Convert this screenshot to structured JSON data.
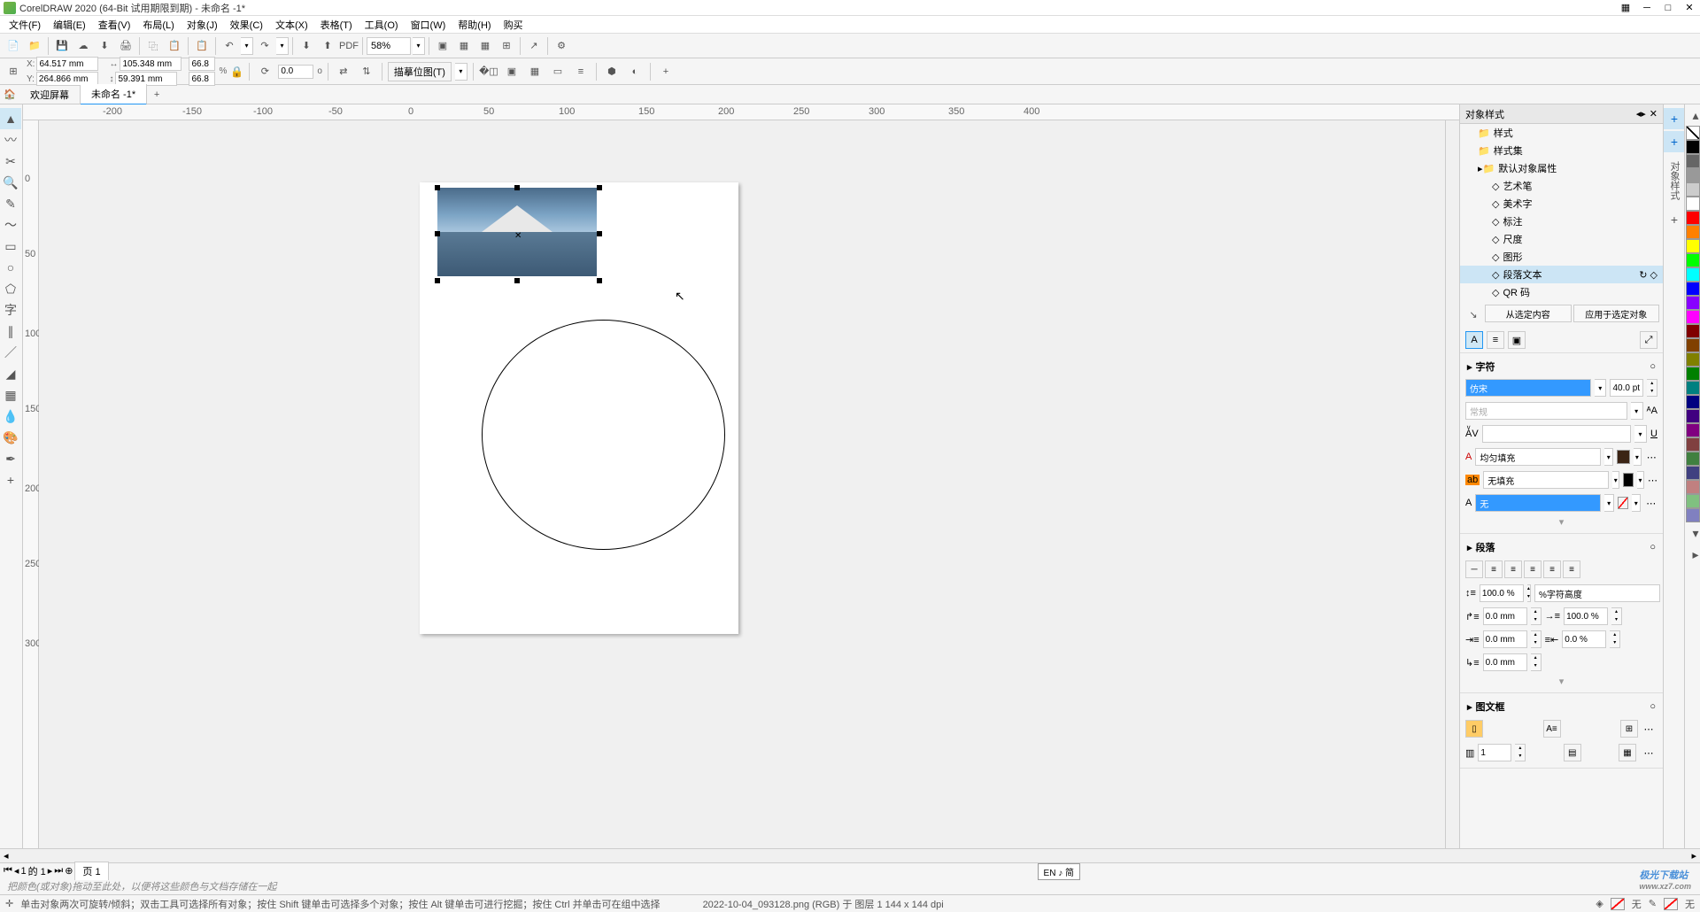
{
  "title": "CorelDRAW 2020 (64-Bit 试用期限到期) - 未命名 -1*",
  "menu": [
    "文件(F)",
    "编辑(E)",
    "查看(V)",
    "布局(L)",
    "对象(J)",
    "效果(C)",
    "文本(X)",
    "表格(T)",
    "工具(O)",
    "窗口(W)",
    "帮助(H)",
    "购买"
  ],
  "zoom": "58%",
  "coords": {
    "x_label": "X:",
    "y_label": "Y:",
    "x": "64.517 mm",
    "y": "264.866 mm",
    "w": "105.348 mm",
    "h": "59.391 mm",
    "sx": "66.8",
    "sy": "66.8",
    "pct": "%",
    "rot": "0.0",
    "deg": "o"
  },
  "trace_label": "描摹位图(T)",
  "tabs": {
    "welcome": "欢迎屏幕",
    "doc": "未命名 -1*"
  },
  "ruler_h": [
    -200,
    -150,
    -100,
    -50,
    0,
    50,
    100,
    150,
    200
  ],
  "styles_panel": {
    "title": "对象样式",
    "items": [
      "样式",
      "样式集",
      "默认对象属性"
    ],
    "sub": [
      "艺术笔",
      "美术字",
      "标注",
      "尺度",
      "图形",
      "段落文本",
      "QR 码"
    ],
    "sel": "段落文本",
    "btn1": "从选定内容",
    "btn2": "应用于选定对象"
  },
  "char": {
    "title": "字符",
    "font": "仿宋",
    "size": "40.0 pt",
    "style": "常规",
    "fill_type": "均匀填充",
    "nofill": "无填充",
    "outline_none": "无"
  },
  "para": {
    "title": "段落",
    "line_height": "100.0 %",
    "mode": "%字符高度",
    "before": "0.0 mm",
    "first": "100.0 %",
    "left": "0.0 mm",
    "right": "0.0 %",
    "after": "0.0 mm"
  },
  "frame": {
    "title": "图文框",
    "cols": "1"
  },
  "page_nav": {
    "current": "1",
    "total": "的 1",
    "page_label": "页 1"
  },
  "hint": "把颜色(或对象)拖动至此处，以便将这些颜色与文档存储在一起",
  "status": {
    "help": "单击对象两次可旋转/倾斜；双击工具可选择所有对象；按住 Shift 键单击可选择多个对象；按住 Alt 键单击可进行挖掘；按住 Ctrl 并单击可在组中选择",
    "file": "2022-10-04_093128.png (RGB) 于 图层 1 144 x 144 dpi",
    "none": "无"
  },
  "ime": "EN ♪ 简",
  "watermark": {
    "main": "极光下载站",
    "sub": "www.xz7.com"
  },
  "colors": [
    "#000",
    "#666",
    "#999",
    "#ccc",
    "#fff",
    "#f00",
    "#ff8000",
    "#ff0",
    "#0f0",
    "#0ff",
    "#00f",
    "#80f",
    "#f0f",
    "#800000",
    "#804000",
    "#808000",
    "#008000",
    "#008080",
    "#000080",
    "#400080",
    "#800080",
    "#804040",
    "#408040",
    "#404080",
    "#c08080",
    "#80c080",
    "#8080c0"
  ]
}
